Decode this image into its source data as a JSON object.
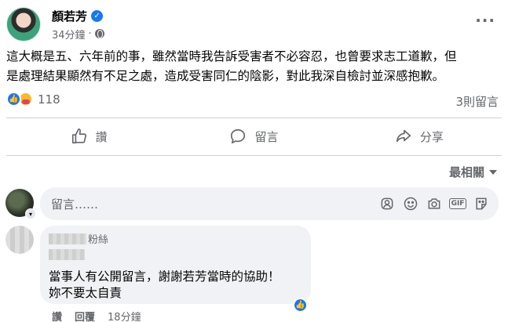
{
  "post": {
    "author": "顏若芳",
    "time": "34分鐘",
    "visibility_icon": "globe-icon",
    "more_icon": "···",
    "text_line1": "這大概是五、六年前的事，雖然當時我告訴受害者不必容忍，也曾要求志工道歉，但",
    "text_line2": "是處理結果顯然有不足之處，造成受害同仁的陰影，對此我深自檢討並深感抱歉。",
    "reaction_count": "118",
    "comment_count": "3則留言"
  },
  "actions": {
    "like": "讚",
    "comment": "留言",
    "share": "分享"
  },
  "sort": {
    "label": "最相關"
  },
  "composer": {
    "placeholder": "留言……"
  },
  "comment": {
    "badge": "粉絲",
    "line1": "當事人有公開留言，謝謝若芳當時的協助！",
    "line2": "妳不要太自責",
    "like": "讚",
    "reply": "回覆",
    "time": "18分鐘",
    "gif_label": "GIF"
  },
  "colors": {
    "accent": "#1877f2",
    "muted": "#65676b",
    "bubble": "#f0f2f5"
  }
}
